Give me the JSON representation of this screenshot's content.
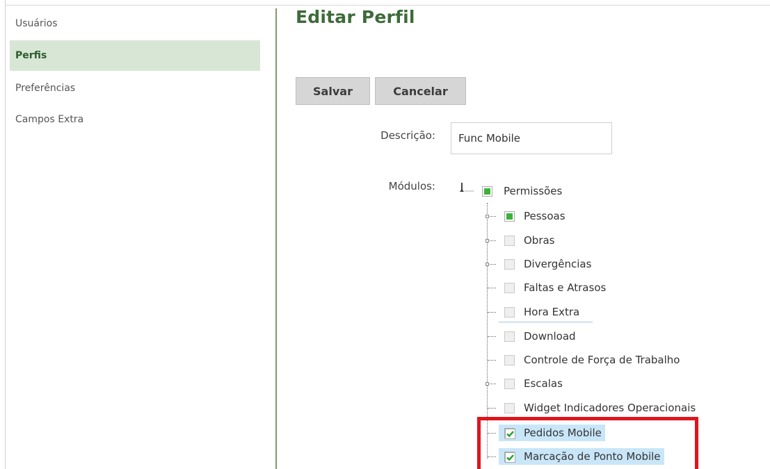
{
  "sidebar": {
    "items": [
      {
        "label": "Usuários",
        "active": false
      },
      {
        "label": "Perfis",
        "active": true
      },
      {
        "label": "Preferências",
        "active": false
      },
      {
        "label": "Campos Extra",
        "active": false
      }
    ]
  },
  "page": {
    "title": "Editar Perfil",
    "save_label": "Salvar",
    "cancel_label": "Cancelar"
  },
  "form": {
    "description_label": "Descrição:",
    "description_value": "Func Mobile",
    "modules_label": "Módulos:"
  },
  "tree": {
    "root": {
      "label": "Permissões",
      "state": "partial"
    },
    "children": [
      {
        "label": "Pessoas",
        "state": "partial"
      },
      {
        "label": "Obras",
        "state": "unchecked"
      },
      {
        "label": "Divergências",
        "state": "unchecked"
      },
      {
        "label": "Faltas e Atrasos",
        "state": "unchecked"
      },
      {
        "label": "Hora Extra",
        "state": "unchecked"
      },
      {
        "label": "Download",
        "state": "unchecked"
      },
      {
        "label": "Controle de Força de Trabalho",
        "state": "unchecked"
      },
      {
        "label": "Escalas",
        "state": "unchecked"
      },
      {
        "label": "Widget Indicadores Operacionais",
        "state": "unchecked"
      },
      {
        "label": "Pedidos Mobile",
        "state": "checked"
      },
      {
        "label": "Marcação de Ponto Mobile",
        "state": "checked"
      }
    ]
  },
  "colors": {
    "title": "#3e6b3a",
    "active_sidebar_bg": "#d8e6d6",
    "highlight_box": "#e0141b",
    "selection_bg": "#c9e6f8",
    "check_green": "#3bb33b"
  }
}
